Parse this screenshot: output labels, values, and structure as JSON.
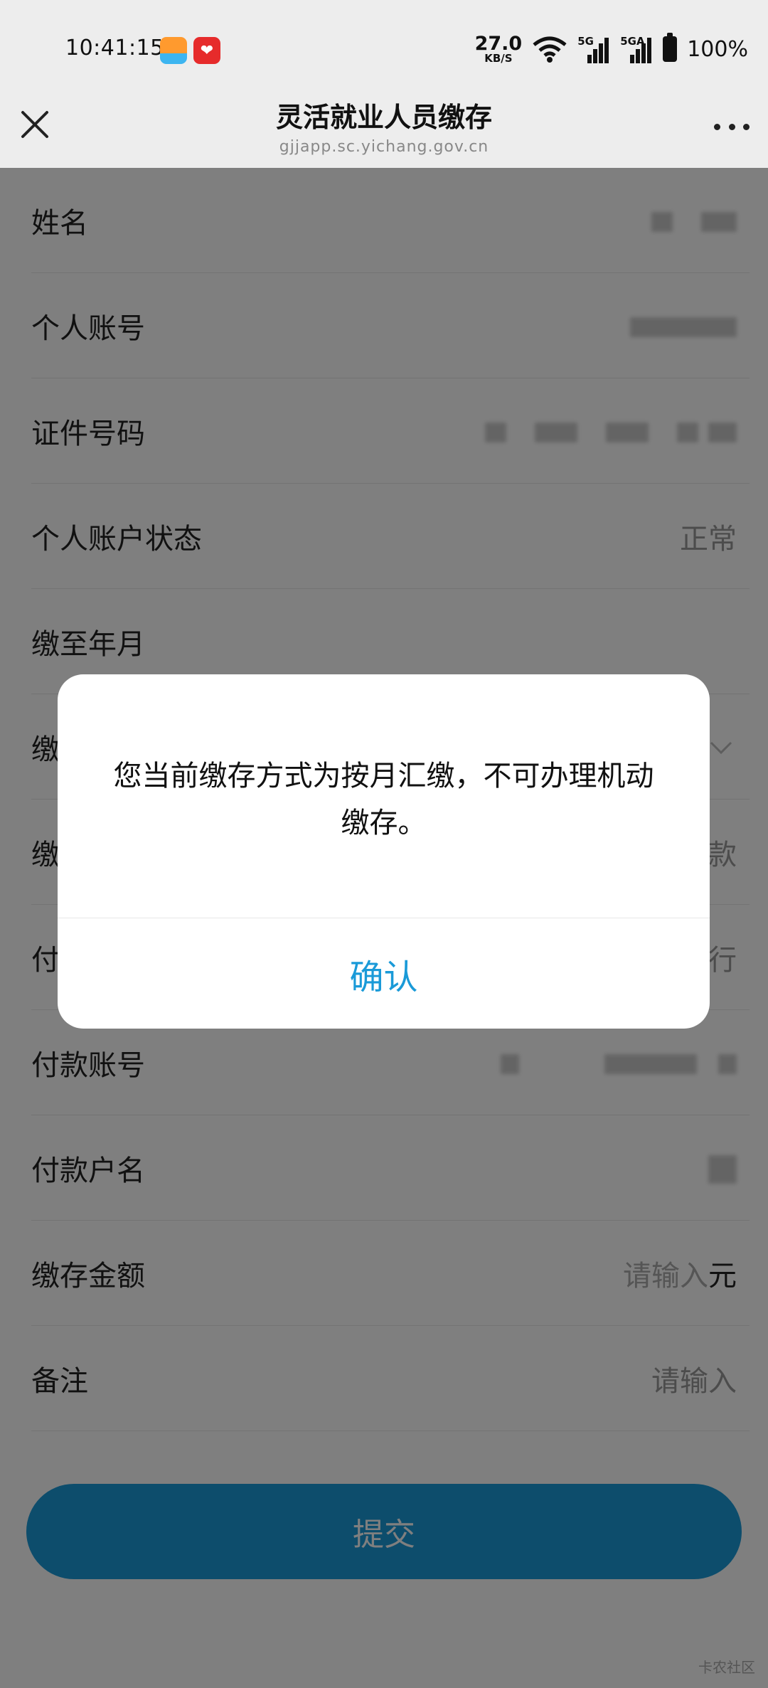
{
  "status_bar": {
    "time": "10:41:15",
    "net_speed": "27.0",
    "net_speed_unit": "KB/S",
    "sim1": "5G",
    "sim2": "5GA",
    "battery": "100%"
  },
  "titlebar": {
    "title": "灵活就业人员缴存",
    "subtitle": "gjjapp.sc.yichang.gov.cn"
  },
  "form": {
    "rows": [
      {
        "label": "姓名",
        "value": ""
      },
      {
        "label": "个人账号",
        "value": ""
      },
      {
        "label": "证件号码",
        "value": ""
      },
      {
        "label": "个人账户状态",
        "value": "正常"
      },
      {
        "label": "缴至年月",
        "value": ""
      },
      {
        "label": "缴",
        "value": ""
      },
      {
        "label": "缴",
        "value": "款"
      },
      {
        "label": "付",
        "value": "行"
      },
      {
        "label": "付款账号",
        "value": ""
      },
      {
        "label": "付款户名",
        "value": ""
      },
      {
        "label": "缴存金额",
        "placeholder": "请输入",
        "unit": "元"
      },
      {
        "label": "备注",
        "placeholder": "请输入"
      }
    ],
    "submit_label": "提交"
  },
  "dialog": {
    "message": "您当前缴存方式为按月汇缴，不可办理机动缴存。",
    "confirm_label": "确认"
  },
  "watermark": "卡农社区",
  "colors": {
    "accent": "#1a9ad8",
    "overlay": "rgba(0,0,0,0.5)"
  }
}
